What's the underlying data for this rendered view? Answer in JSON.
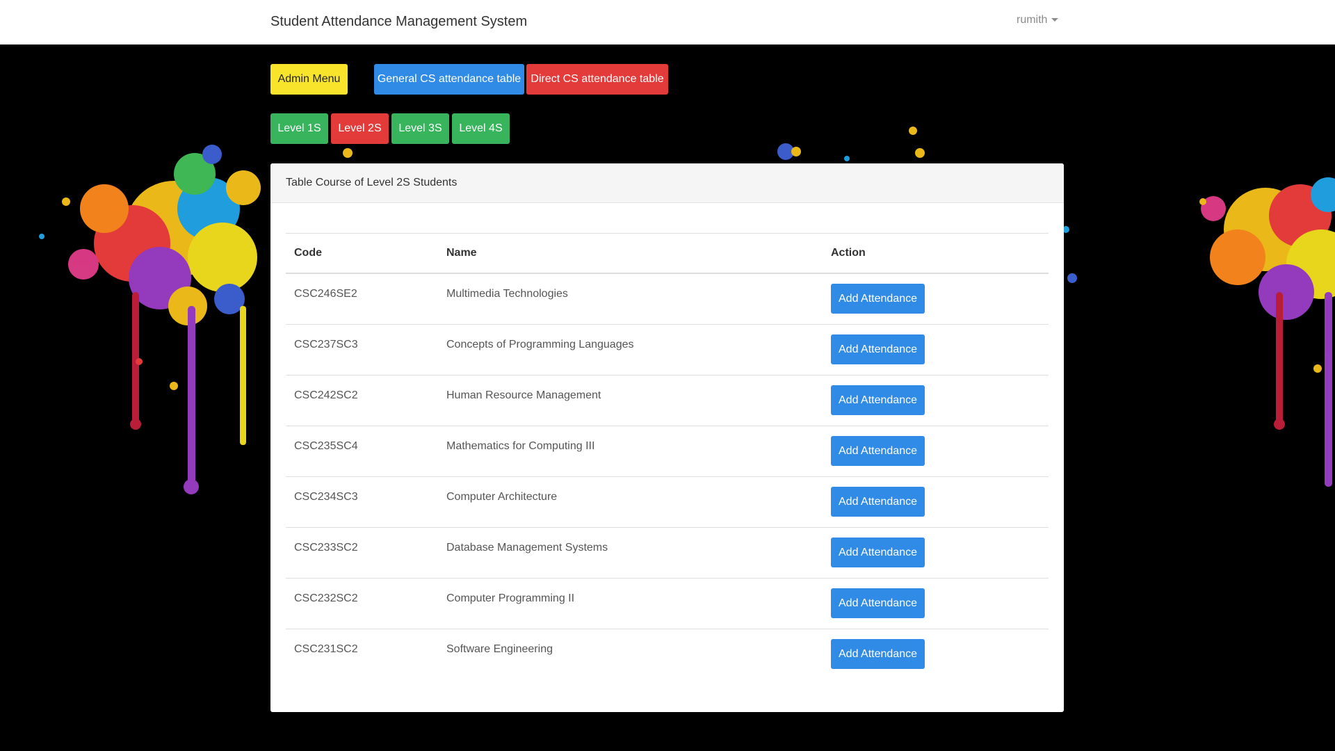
{
  "navbar": {
    "brand": "Student Attendance Management System",
    "user": "rumith"
  },
  "buttons": {
    "admin_menu": "Admin Menu",
    "general_table": "General CS attendance table",
    "direct_table": "Direct CS attendance table"
  },
  "levels": [
    "Level 1S",
    "Level 2S",
    "Level 3S",
    "Level 4S"
  ],
  "panel": {
    "title": "Table Course of Level 2S Students",
    "columns": [
      "Code",
      "Name",
      "Action"
    ],
    "action_label": "Add Attendance",
    "rows": [
      {
        "code": "CSC246SE2",
        "name": "Multimedia Technologies"
      },
      {
        "code": "CSC237SC3",
        "name": "Concepts of Programming Languages"
      },
      {
        "code": "CSC242SC2",
        "name": "Human Resource Management"
      },
      {
        "code": "CSC235SC4",
        "name": "Mathematics for Computing III"
      },
      {
        "code": "CSC234SC3",
        "name": "Computer Architecture"
      },
      {
        "code": "CSC233SC2",
        "name": "Database Management Systems"
      },
      {
        "code": "CSC232SC2",
        "name": "Computer Programming II"
      },
      {
        "code": "CSC231SC2",
        "name": "Software Engineering"
      }
    ]
  },
  "colors": {
    "yellow": "#f8e42b",
    "blue": "#2f8be6",
    "red": "#e33a3a",
    "green": "#38b45d"
  }
}
